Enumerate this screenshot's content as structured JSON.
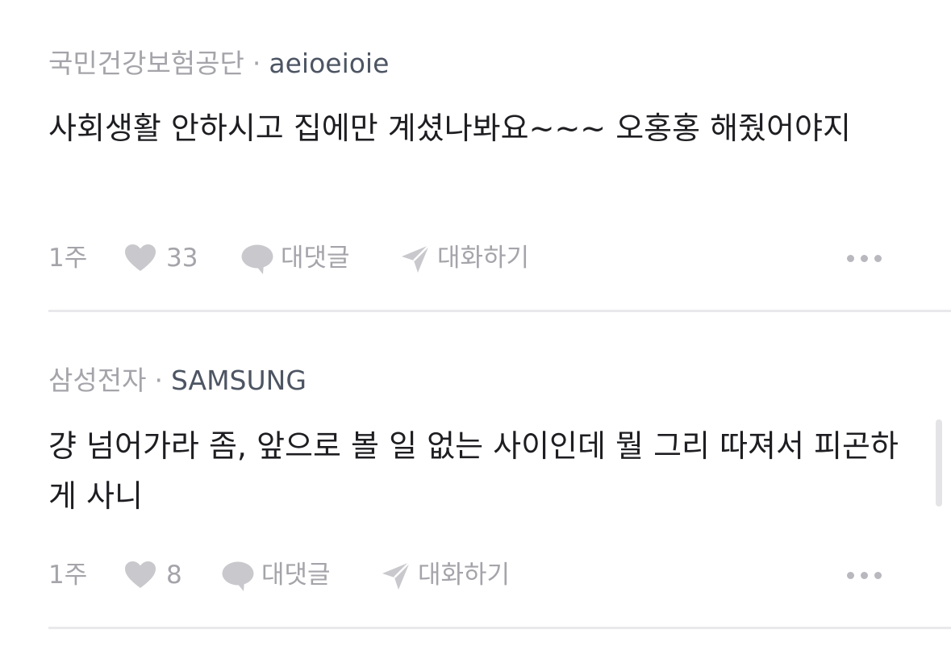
{
  "comments": [
    {
      "company": "국민건강보험공단",
      "separator": "·",
      "author": "aeioeioie",
      "body": "사회생활 안하시고 집에만 계셨나봐요~~~ 오홍홍 해줬어야지",
      "time": "1주",
      "likes": "33",
      "reply_label": "대댓글",
      "chat_label": "대화하기"
    },
    {
      "company": "삼성전자",
      "separator": "·",
      "author": "SAMSUNG",
      "body": "걍 넘어가라 좀, 앞으로 볼 일 없는 사이인데 뭘 그리 따져서 피곤하게 사니",
      "time": "1주",
      "likes": "8",
      "reply_label": "대댓글",
      "chat_label": "대화하기"
    }
  ],
  "icons": {
    "like": "heart-icon",
    "reply": "speech-bubble-icon",
    "chat": "paper-plane-icon",
    "more": "more-dots-icon"
  },
  "colors": {
    "meta_gray": "#a4a4aa",
    "author": "#4d5563",
    "body_text": "#1e1e22",
    "icon_gray": "#c8c8cd",
    "divider": "#e9e9ec"
  }
}
